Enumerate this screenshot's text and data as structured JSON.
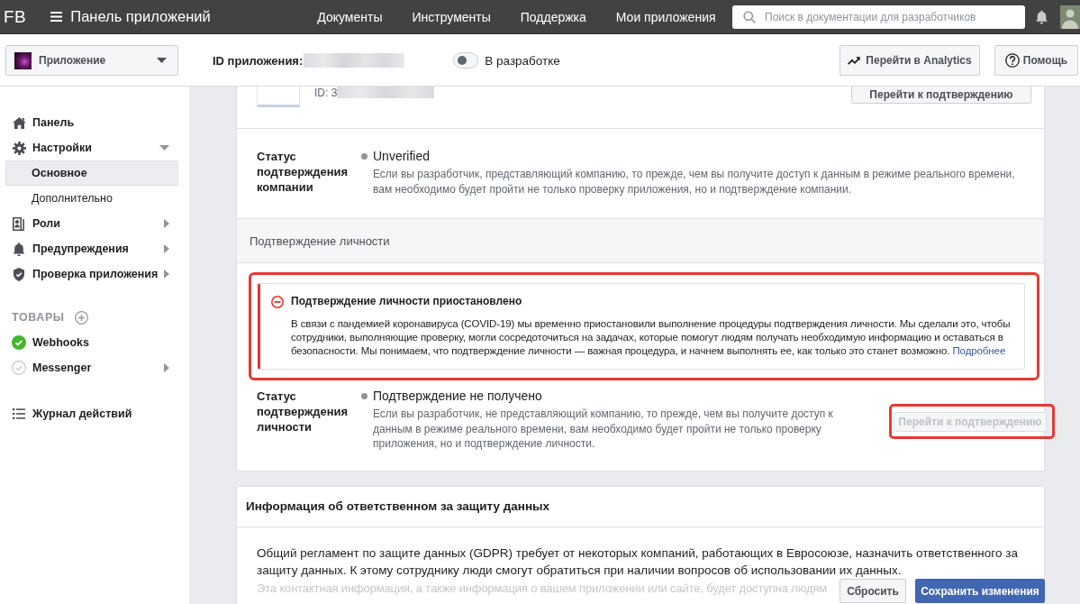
{
  "top_bar": {
    "logo": "FB",
    "title": "Панель приложений",
    "nav": [
      {
        "label": "Документы"
      },
      {
        "label": "Инструменты"
      },
      {
        "label": "Поддержка"
      },
      {
        "label": "Мои приложения"
      }
    ],
    "search": {
      "placeholder": "Поиск в документации для разработчиков"
    }
  },
  "app_bar": {
    "app_selector": {
      "label": "Приложение"
    },
    "app_id_label": "ID приложения:",
    "dev_mode": {
      "label": "В разработке",
      "on": false
    },
    "buttons": [
      {
        "kind": "analytics",
        "label": "Перейти в Analytics"
      },
      {
        "kind": "help",
        "label": "Помощь"
      }
    ]
  },
  "sidebar": {
    "items": [
      {
        "kind": "link",
        "label": "Панель",
        "selected": false
      },
      {
        "kind": "group",
        "label": "Настройки",
        "selected": false,
        "expanded": true,
        "children": [
          {
            "label": "Основное",
            "selected": true
          },
          {
            "label": "Дополнительно",
            "selected": false
          }
        ]
      },
      {
        "kind": "group",
        "label": "Роли",
        "selected": false,
        "expanded": false
      },
      {
        "kind": "group",
        "label": "Предупреждения",
        "selected": false,
        "expanded": false
      },
      {
        "kind": "group",
        "label": "Проверка приложения",
        "selected": false,
        "expanded": false
      }
    ],
    "products": {
      "title": "ТОВАРЫ",
      "items": [
        {
          "kind": "link",
          "label": "Webhooks",
          "selected": false,
          "configured": true
        },
        {
          "kind": "group",
          "label": "Messenger",
          "selected": false,
          "configured": false,
          "expanded": false
        }
      ]
    },
    "log_item": {
      "label": "Журнал действий"
    }
  },
  "main": {
    "app_card": {
      "id_label": "ID: 3",
      "button": {
        "label": "Перейти к подтверждению"
      }
    },
    "business_verification": {
      "label": "Статус подтверждения компании",
      "status": "Unverified",
      "description": "Если вы разработчик, представляющий компанию, то прежде, чем вы получите доступ к данным в режиме реального времени, вам необходимо будет пройти не только проверку приложения, но и подтверждение компании."
    },
    "identity_verification": {
      "title": "Подтверждение личности",
      "alert": {
        "highlighted": true,
        "title": "Подтверждение личности приостановлено",
        "text": "В связи с пандемией коронавируса (COVID-19) мы временно приостановили выполнение процедуры подтверждения личности. Мы сделали это, чтобы сотрудники, выполняющие проверку, могли сосредоточиться на задачах, которые помогут людям получать необходимую информацию и оставаться в безопасности. Мы понимаем, что подтверждение личности — важная процедура, и начнем выполнять ее, как только это станет возможно.",
        "link": "Подробнее"
      },
      "label": "Статус подтверждения личности",
      "status": "Подтверждение не получено",
      "description": "Если вы разработчик, не представляющий компанию, то прежде, чем вы получите доступ к данным в режиме реального времени, вам необходимо будет пройти не только проверку приложения, но и подтверждение личности.",
      "button": {
        "label": "Перейти к подтверждению",
        "disabled": true,
        "highlighted": true
      }
    },
    "data_protection": {
      "title": "Информация об ответственном за защиту данных",
      "paragraphs": [
        "Общий регламент по защите данных (GDPR) требует от некоторых компаний, работающих в Евросоюзе, назначить ответственного за защиту данных. К этому сотруднику люди смогут обратиться при наличии вопросов об использовании их данных.",
        "Эта контактная информация, а также информация о вашем приложении или сайте, будет доступна людям"
      ]
    }
  },
  "footer": {
    "buttons": [
      {
        "kind": "secondary",
        "label": "Сбросить"
      },
      {
        "kind": "primary",
        "label": "Сохранить изменения"
      }
    ]
  }
}
